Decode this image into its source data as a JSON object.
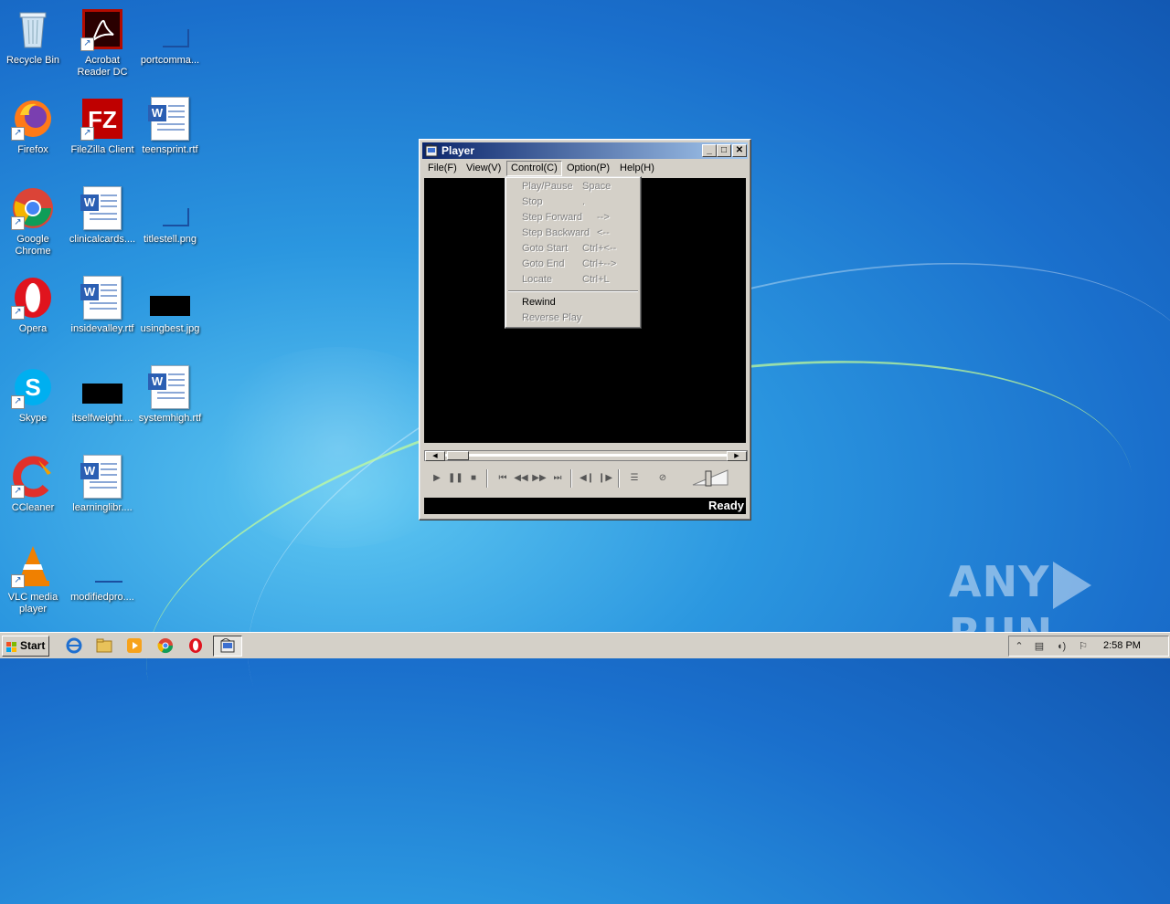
{
  "desktop": {
    "icons": [
      {
        "label": "Recycle Bin",
        "icon": "recycle-bin-icon"
      },
      {
        "label": "Acrobat Reader DC",
        "icon": "acrobat-icon"
      },
      {
        "label": "portcomma...",
        "icon": "file-icon"
      },
      {
        "label": "Firefox",
        "icon": "firefox-icon"
      },
      {
        "label": "FileZilla Client",
        "icon": "filezilla-icon"
      },
      {
        "label": "teensprint.rtf",
        "icon": "word-doc-icon"
      },
      {
        "label": "Google Chrome",
        "icon": "chrome-icon"
      },
      {
        "label": "clinicalcards....",
        "icon": "word-doc-icon"
      },
      {
        "label": "titlestell.png",
        "icon": "image-file-icon"
      },
      {
        "label": "Opera",
        "icon": "opera-icon"
      },
      {
        "label": "insidevalley.rtf",
        "icon": "word-doc-icon"
      },
      {
        "label": "usingbest.jpg",
        "icon": "image-file-icon"
      },
      {
        "label": "Skype",
        "icon": "skype-icon"
      },
      {
        "label": "itselfweight....",
        "icon": "black-file-icon"
      },
      {
        "label": "systemhigh.rtf",
        "icon": "word-doc-icon"
      },
      {
        "label": "CCleaner",
        "icon": "ccleaner-icon"
      },
      {
        "label": "learninglibr....",
        "icon": "word-doc-icon"
      },
      {
        "label": "VLC media player",
        "icon": "vlc-icon"
      },
      {
        "label": "modifiedpro....",
        "icon": "file-icon"
      }
    ]
  },
  "window": {
    "title": "Player",
    "menu": [
      "File(F)",
      "View(V)",
      "Control(C)",
      "Option(P)",
      "Help(H)"
    ],
    "status": "Ready"
  },
  "control_menu": {
    "items": [
      {
        "label": "Play/Pause",
        "shortcut": "Space",
        "enabled": false
      },
      {
        "label": "Stop",
        "shortcut": ".",
        "enabled": false
      },
      {
        "label": "Step Forward",
        "shortcut": "-->",
        "enabled": false
      },
      {
        "label": "Step Backward",
        "shortcut": "<--",
        "enabled": false
      },
      {
        "label": "Goto Start",
        "shortcut": "Ctrl+<--",
        "enabled": false
      },
      {
        "label": "Goto End",
        "shortcut": "Ctrl+-->",
        "enabled": false
      },
      {
        "label": "Locate",
        "shortcut": "Ctrl+L",
        "enabled": false
      },
      {
        "label": "Rewind",
        "shortcut": "",
        "enabled": true
      },
      {
        "label": "Reverse Play",
        "shortcut": "",
        "enabled": false
      }
    ]
  },
  "taskbar": {
    "start_label": "Start",
    "clock": "2:58 PM"
  },
  "watermark": {
    "left": "ANY",
    "right": "RUN"
  }
}
